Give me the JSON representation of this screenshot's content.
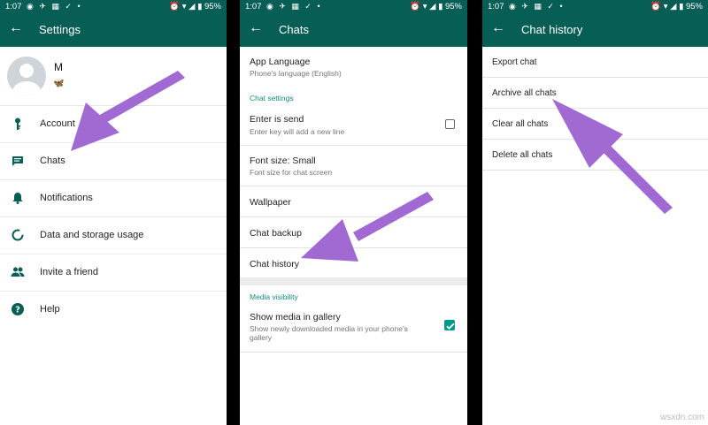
{
  "statusbar": {
    "time": "1:07",
    "battery": "95%"
  },
  "settings": {
    "title": "Settings",
    "profile": {
      "name": "M",
      "status": "🦋"
    },
    "items": [
      {
        "label": "Account",
        "icon": "key-icon"
      },
      {
        "label": "Chats",
        "icon": "chat-icon"
      },
      {
        "label": "Notifications",
        "icon": "bell-icon"
      },
      {
        "label": "Data and storage usage",
        "icon": "data-usage-icon"
      },
      {
        "label": "Invite a friend",
        "icon": "people-icon"
      },
      {
        "label": "Help",
        "icon": "help-icon"
      }
    ]
  },
  "chats": {
    "title": "Chats",
    "app_language": {
      "title": "App Language",
      "subtitle": "Phone's language (English)"
    },
    "section_chat_settings": "Chat settings",
    "enter_is_send": {
      "title": "Enter is send",
      "subtitle": "Enter key will add a new line",
      "checked": false
    },
    "font_size": {
      "title": "Font size: Small",
      "subtitle": "Font size for chat screen"
    },
    "wallpaper": "Wallpaper",
    "chat_backup": "Chat backup",
    "chat_history": "Chat history",
    "section_media": "Media visibility",
    "show_media": {
      "title": "Show media in gallery",
      "subtitle": "Show newly downloaded media in your phone's gallery",
      "checked": true
    }
  },
  "chat_history": {
    "title": "Chat history",
    "items": [
      "Export chat",
      "Archive all chats",
      "Clear all chats",
      "Delete all chats"
    ]
  },
  "watermark": "wsxdn.com",
  "colors": {
    "header": "#075e54",
    "accent": "#128c7e",
    "arrow": "#a06ad2",
    "check": "#009688"
  }
}
